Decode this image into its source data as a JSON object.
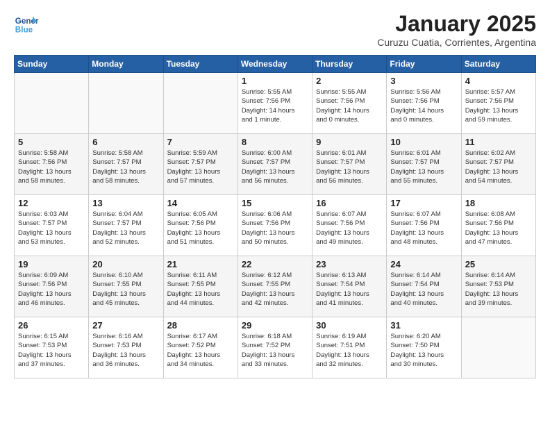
{
  "header": {
    "logo_line1": "General",
    "logo_line2": "Blue",
    "title": "January 2025",
    "subtitle": "Curuzu Cuatia, Corrientes, Argentina"
  },
  "days_of_week": [
    "Sunday",
    "Monday",
    "Tuesday",
    "Wednesday",
    "Thursday",
    "Friday",
    "Saturday"
  ],
  "weeks": [
    [
      {
        "day": "",
        "info": ""
      },
      {
        "day": "",
        "info": ""
      },
      {
        "day": "",
        "info": ""
      },
      {
        "day": "1",
        "info": "Sunrise: 5:55 AM\nSunset: 7:56 PM\nDaylight: 14 hours\nand 1 minute."
      },
      {
        "day": "2",
        "info": "Sunrise: 5:55 AM\nSunset: 7:56 PM\nDaylight: 14 hours\nand 0 minutes."
      },
      {
        "day": "3",
        "info": "Sunrise: 5:56 AM\nSunset: 7:56 PM\nDaylight: 14 hours\nand 0 minutes."
      },
      {
        "day": "4",
        "info": "Sunrise: 5:57 AM\nSunset: 7:56 PM\nDaylight: 13 hours\nand 59 minutes."
      }
    ],
    [
      {
        "day": "5",
        "info": "Sunrise: 5:58 AM\nSunset: 7:56 PM\nDaylight: 13 hours\nand 58 minutes."
      },
      {
        "day": "6",
        "info": "Sunrise: 5:58 AM\nSunset: 7:57 PM\nDaylight: 13 hours\nand 58 minutes."
      },
      {
        "day": "7",
        "info": "Sunrise: 5:59 AM\nSunset: 7:57 PM\nDaylight: 13 hours\nand 57 minutes."
      },
      {
        "day": "8",
        "info": "Sunrise: 6:00 AM\nSunset: 7:57 PM\nDaylight: 13 hours\nand 56 minutes."
      },
      {
        "day": "9",
        "info": "Sunrise: 6:01 AM\nSunset: 7:57 PM\nDaylight: 13 hours\nand 56 minutes."
      },
      {
        "day": "10",
        "info": "Sunrise: 6:01 AM\nSunset: 7:57 PM\nDaylight: 13 hours\nand 55 minutes."
      },
      {
        "day": "11",
        "info": "Sunrise: 6:02 AM\nSunset: 7:57 PM\nDaylight: 13 hours\nand 54 minutes."
      }
    ],
    [
      {
        "day": "12",
        "info": "Sunrise: 6:03 AM\nSunset: 7:57 PM\nDaylight: 13 hours\nand 53 minutes."
      },
      {
        "day": "13",
        "info": "Sunrise: 6:04 AM\nSunset: 7:57 PM\nDaylight: 13 hours\nand 52 minutes."
      },
      {
        "day": "14",
        "info": "Sunrise: 6:05 AM\nSunset: 7:56 PM\nDaylight: 13 hours\nand 51 minutes."
      },
      {
        "day": "15",
        "info": "Sunrise: 6:06 AM\nSunset: 7:56 PM\nDaylight: 13 hours\nand 50 minutes."
      },
      {
        "day": "16",
        "info": "Sunrise: 6:07 AM\nSunset: 7:56 PM\nDaylight: 13 hours\nand 49 minutes."
      },
      {
        "day": "17",
        "info": "Sunrise: 6:07 AM\nSunset: 7:56 PM\nDaylight: 13 hours\nand 48 minutes."
      },
      {
        "day": "18",
        "info": "Sunrise: 6:08 AM\nSunset: 7:56 PM\nDaylight: 13 hours\nand 47 minutes."
      }
    ],
    [
      {
        "day": "19",
        "info": "Sunrise: 6:09 AM\nSunset: 7:56 PM\nDaylight: 13 hours\nand 46 minutes."
      },
      {
        "day": "20",
        "info": "Sunrise: 6:10 AM\nSunset: 7:55 PM\nDaylight: 13 hours\nand 45 minutes."
      },
      {
        "day": "21",
        "info": "Sunrise: 6:11 AM\nSunset: 7:55 PM\nDaylight: 13 hours\nand 44 minutes."
      },
      {
        "day": "22",
        "info": "Sunrise: 6:12 AM\nSunset: 7:55 PM\nDaylight: 13 hours\nand 42 minutes."
      },
      {
        "day": "23",
        "info": "Sunrise: 6:13 AM\nSunset: 7:54 PM\nDaylight: 13 hours\nand 41 minutes."
      },
      {
        "day": "24",
        "info": "Sunrise: 6:14 AM\nSunset: 7:54 PM\nDaylight: 13 hours\nand 40 minutes."
      },
      {
        "day": "25",
        "info": "Sunrise: 6:14 AM\nSunset: 7:53 PM\nDaylight: 13 hours\nand 39 minutes."
      }
    ],
    [
      {
        "day": "26",
        "info": "Sunrise: 6:15 AM\nSunset: 7:53 PM\nDaylight: 13 hours\nand 37 minutes."
      },
      {
        "day": "27",
        "info": "Sunrise: 6:16 AM\nSunset: 7:53 PM\nDaylight: 13 hours\nand 36 minutes."
      },
      {
        "day": "28",
        "info": "Sunrise: 6:17 AM\nSunset: 7:52 PM\nDaylight: 13 hours\nand 34 minutes."
      },
      {
        "day": "29",
        "info": "Sunrise: 6:18 AM\nSunset: 7:52 PM\nDaylight: 13 hours\nand 33 minutes."
      },
      {
        "day": "30",
        "info": "Sunrise: 6:19 AM\nSunset: 7:51 PM\nDaylight: 13 hours\nand 32 minutes."
      },
      {
        "day": "31",
        "info": "Sunrise: 6:20 AM\nSunset: 7:50 PM\nDaylight: 13 hours\nand 30 minutes."
      },
      {
        "day": "",
        "info": ""
      }
    ]
  ]
}
